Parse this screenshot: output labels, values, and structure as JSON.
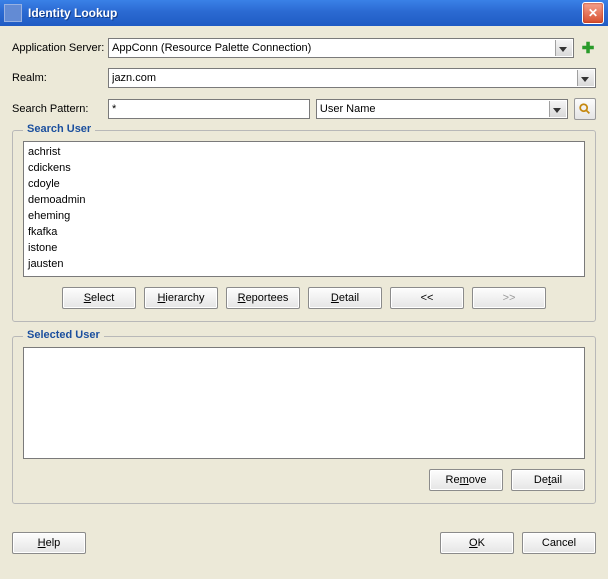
{
  "window": {
    "title": "Identity Lookup"
  },
  "form": {
    "appserver_label": "Application Server:",
    "appserver_value": "AppConn (Resource Palette Connection)",
    "realm_label": "Realm:",
    "realm_value": "jazn.com",
    "searchpattern_label": "Search Pattern:",
    "searchpattern_value": "*",
    "searchtype_value": "User Name"
  },
  "search_group": {
    "legend": "Search User",
    "users": [
      "achrist",
      "cdickens",
      "cdoyle",
      "demoadmin",
      "eheming",
      "fkafka",
      "istone",
      "jausten"
    ],
    "buttons": {
      "select": {
        "pre": "",
        "u": "S",
        "post": "elect"
      },
      "hierarchy": {
        "pre": "",
        "u": "H",
        "post": "ierarchy"
      },
      "reportees": {
        "pre": "",
        "u": "R",
        "post": "eportees"
      },
      "detail": {
        "pre": "",
        "u": "D",
        "post": "etail"
      },
      "prev": "<<",
      "next": ">>"
    }
  },
  "selected_group": {
    "legend": "Selected User",
    "buttons": {
      "remove": {
        "pre": "Re",
        "u": "m",
        "post": "ove"
      },
      "detail": {
        "pre": "De",
        "u": "t",
        "post": "ail"
      }
    }
  },
  "footer": {
    "help": {
      "pre": "",
      "u": "H",
      "post": "elp"
    },
    "ok": {
      "pre": "",
      "u": "O",
      "post": "K"
    },
    "cancel": "Cancel"
  }
}
